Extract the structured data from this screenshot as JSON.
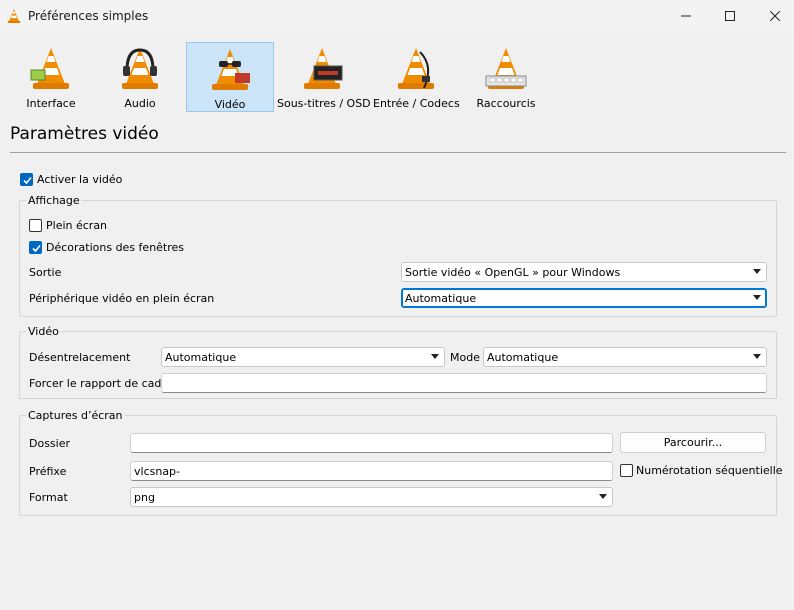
{
  "window": {
    "title": "Préférences simples",
    "icons": {
      "app": "vlc-cone-icon",
      "minimize": "minimize-icon",
      "maximize": "maximize-icon",
      "close": "close-icon"
    }
  },
  "toolbar": {
    "items": [
      {
        "label": "Interface",
        "icon": "interface-cone-icon",
        "selected": false
      },
      {
        "label": "Audio",
        "icon": "audio-headphones-cone-icon",
        "selected": false
      },
      {
        "label": "Vidéo",
        "icon": "video-glasses-cone-icon",
        "selected": true
      },
      {
        "label": "Sous-titres / OSD",
        "icon": "subtitles-cone-icon",
        "selected": false
      },
      {
        "label": "Entrée / Codecs",
        "icon": "input-codecs-cone-icon",
        "selected": false
      },
      {
        "label": "Raccourcis",
        "icon": "hotkeys-cone-icon",
        "selected": false
      }
    ]
  },
  "page": {
    "title": "Paramètres vidéo",
    "enable_video": {
      "label": "Activer la vidéo",
      "checked": true
    }
  },
  "display_group": {
    "title": "Affichage",
    "fullscreen": {
      "label": "Plein écran",
      "checked": false
    },
    "decorations": {
      "label": "Décorations des fenêtres",
      "checked": true
    },
    "output": {
      "label": "Sortie",
      "value": "Sortie vidéo « OpenGL » pour Windows"
    },
    "fullscreen_device": {
      "label": "Périphérique vidéo en plein écran",
      "value": "Automatique"
    }
  },
  "video_group": {
    "title": "Vidéo",
    "deinterlace": {
      "label": "Désentrelacement",
      "value": "Automatique"
    },
    "mode": {
      "label": "Mode",
      "value": "Automatique"
    },
    "aspect_ratio": {
      "label": "Forcer le rapport de cadre",
      "value": ""
    }
  },
  "snapshot_group": {
    "title": "Captures d’écran",
    "folder": {
      "label": "Dossier",
      "value": ""
    },
    "browse_label": "Parcourir...",
    "prefix": {
      "label": "Préfixe",
      "value": "vlcsnap-"
    },
    "sequential": {
      "label": "Numérotation séquentielle",
      "checked": false
    },
    "format": {
      "label": "Format",
      "value": "png"
    }
  },
  "colors": {
    "accent": "#0067c0",
    "selected_tab_bg": "#cce4f7",
    "cone_orange": "#f08c00"
  }
}
